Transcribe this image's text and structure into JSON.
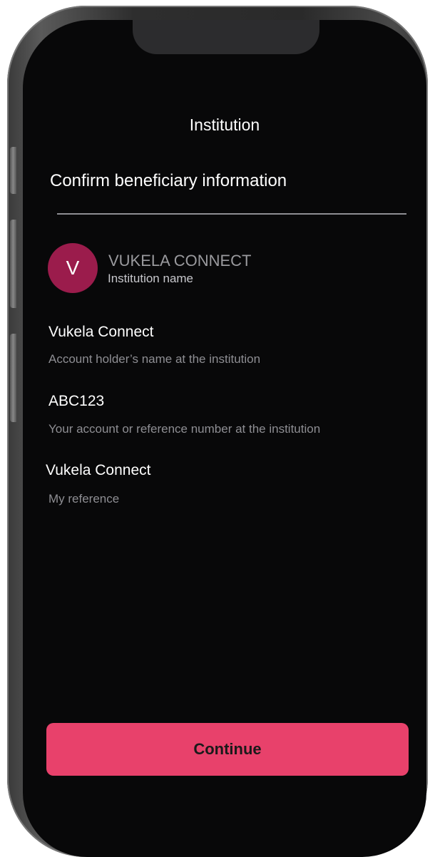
{
  "header": {
    "title": "Institution"
  },
  "page": {
    "heading": "Confirm beneficiary information"
  },
  "institution": {
    "avatar_letter": "V",
    "name": "VUKELA CONNECT",
    "name_label": "Institution name"
  },
  "fields": [
    {
      "value": "Vukela Connect",
      "label": "Account holder’s name at the institution"
    },
    {
      "value": "ABC123",
      "label": "Your account or reference number at the institution"
    },
    {
      "value": "Vukela Connect",
      "label": "My reference"
    }
  ],
  "actions": {
    "continue_label": "Continue"
  },
  "colors": {
    "accent": "#e8416b",
    "avatar": "#9b1c4c",
    "background": "#080809"
  }
}
